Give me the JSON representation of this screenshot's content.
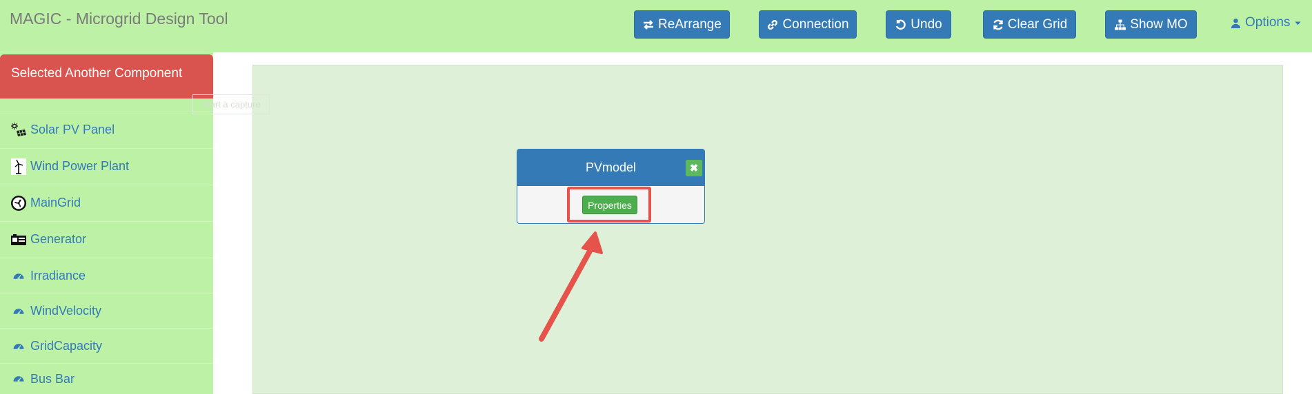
{
  "app": {
    "title": "MAGIC - Microgrid Design Tool"
  },
  "toolbar": {
    "buttons": [
      {
        "label": "ReArrange",
        "icon": "swap-icon"
      },
      {
        "label": "Connection",
        "icon": "link-icon"
      },
      {
        "label": "Undo",
        "icon": "undo-icon"
      },
      {
        "label": "Clear Grid",
        "icon": "refresh-icon"
      },
      {
        "label": "Show MO",
        "icon": "sitemap-icon"
      }
    ],
    "options_label": "Options"
  },
  "sidebar": {
    "alert": "Selected Another Component",
    "items": [
      {
        "label": "Solar PV Panel",
        "icon": "solar-panel-icon"
      },
      {
        "label": "Wind Power Plant",
        "icon": "wind-turbine-icon"
      },
      {
        "label": "MainGrid",
        "icon": "fan-icon"
      },
      {
        "label": "Generator",
        "icon": "generator-icon"
      },
      {
        "label": "Irradiance",
        "icon": "dashboard-icon"
      },
      {
        "label": "WindVelocity",
        "icon": "dashboard-icon"
      },
      {
        "label": "GridCapacity",
        "icon": "dashboard-icon"
      },
      {
        "label": "Bus Bar",
        "icon": "dashboard-icon"
      }
    ]
  },
  "canvas": {
    "tooltip": "Start a capture",
    "node": {
      "title": "PVmodel",
      "close_symbol": "✖",
      "properties_label": "Properties"
    }
  },
  "colors": {
    "topbar": "#bdf2a6",
    "primary": "#337ab7",
    "danger": "#d9534f",
    "success": "#4cae4c",
    "canvas": "#def0d8",
    "annotation": "#e5534b"
  }
}
